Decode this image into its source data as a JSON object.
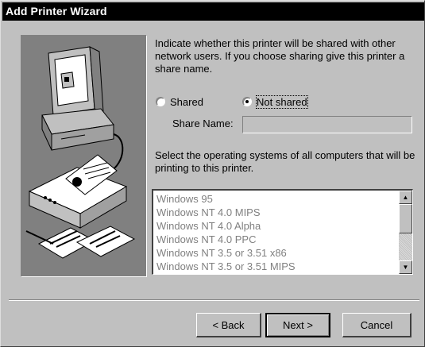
{
  "window": {
    "title": "Add Printer Wizard"
  },
  "description": "Indicate whether this printer will be shared with other network users. If you choose sharing give this printer a share name.",
  "sharing": {
    "shared_label": "Shared",
    "not_shared_label": "Not shared",
    "selected": "not_shared"
  },
  "share_name": {
    "label": "Share Name:",
    "value": ""
  },
  "os_instructions": "Select the operating systems of all computers that will be printing to this printer.",
  "os_list": {
    "items": [
      "Windows 95",
      "Windows NT 4.0 MIPS",
      "Windows NT 4.0 Alpha",
      "Windows NT 4.0 PPC",
      "Windows NT 3.5 or 3.51 x86",
      "Windows NT 3.5 or 3.51 MIPS"
    ]
  },
  "buttons": {
    "back": "< Back",
    "next": "Next >",
    "cancel": "Cancel"
  },
  "colors": {
    "face": "#c0c0c0",
    "title_bar": "#000000",
    "disabled_text": "#808080"
  }
}
